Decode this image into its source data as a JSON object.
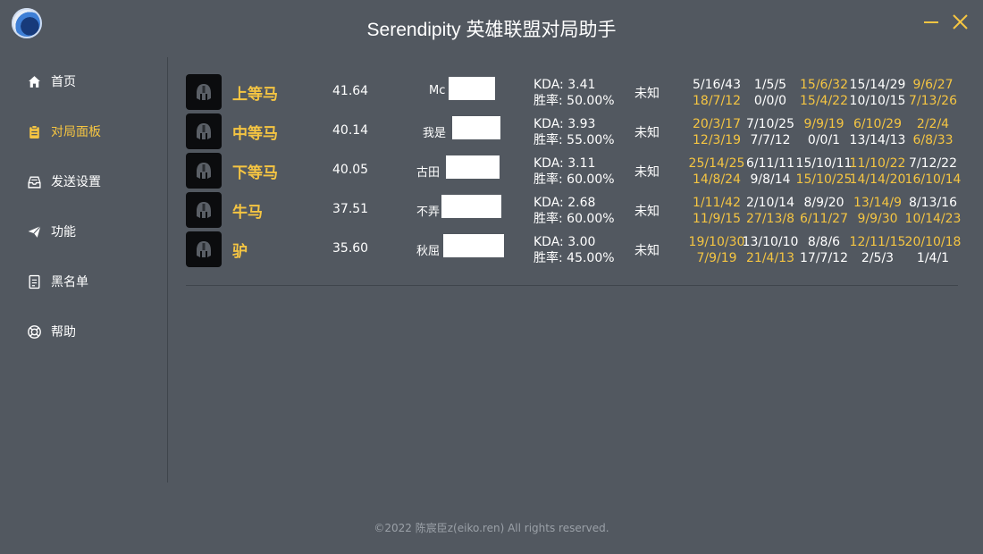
{
  "app": {
    "title": "Serendipity 英雄联盟对局助手"
  },
  "nav": [
    {
      "label": "首页",
      "icon": "home-icon",
      "active": false
    },
    {
      "label": "对局面板",
      "icon": "clipboard-icon",
      "active": true
    },
    {
      "label": "发送设置",
      "icon": "inbox-icon",
      "active": false
    },
    {
      "label": "功能",
      "icon": "send-icon",
      "active": false
    },
    {
      "label": "黑名单",
      "icon": "document-icon",
      "active": false
    },
    {
      "label": "帮助",
      "icon": "lifebuoy-icon",
      "active": false
    }
  ],
  "players": [
    {
      "tier": "上等马",
      "score": "41.64",
      "name_visible": "Mc",
      "kda": "KDA: 3.41",
      "winrate": "胜率: 50.00%",
      "rank": "未知",
      "games": [
        {
          "top": "5/16/43",
          "top_win": false,
          "bottom": "18/7/12",
          "bottom_win": true
        },
        {
          "top": "1/5/5",
          "top_win": false,
          "bottom": "0/0/0",
          "bottom_win": false
        },
        {
          "top": "15/6/32",
          "top_win": true,
          "bottom": "15/4/22",
          "bottom_win": true
        },
        {
          "top": "15/14/29",
          "top_win": false,
          "bottom": "10/10/15",
          "bottom_win": false
        },
        {
          "top": "9/6/27",
          "top_win": true,
          "bottom": "7/13/26",
          "bottom_win": true
        }
      ]
    },
    {
      "tier": "中等马",
      "score": "40.14",
      "name_visible": "我是",
      "kda": "KDA: 3.93",
      "winrate": "胜率: 55.00%",
      "rank": "未知",
      "games": [
        {
          "top": "20/3/17",
          "top_win": true,
          "bottom": "12/3/19",
          "bottom_win": true
        },
        {
          "top": "7/10/25",
          "top_win": false,
          "bottom": "7/7/12",
          "bottom_win": false
        },
        {
          "top": "9/9/19",
          "top_win": true,
          "bottom": "0/0/1",
          "bottom_win": false
        },
        {
          "top": "6/10/29",
          "top_win": true,
          "bottom": "13/14/13",
          "bottom_win": false
        },
        {
          "top": "2/2/4",
          "top_win": true,
          "bottom": "6/8/33",
          "bottom_win": true
        }
      ]
    },
    {
      "tier": "下等马",
      "score": "40.05",
      "name_visible": "古田",
      "kda": "KDA: 3.11",
      "winrate": "胜率: 60.00%",
      "rank": "未知",
      "games": [
        {
          "top": "25/14/25",
          "top_win": true,
          "bottom": "14/8/24",
          "bottom_win": true
        },
        {
          "top": "6/11/11",
          "top_win": false,
          "bottom": "9/8/14",
          "bottom_win": false
        },
        {
          "top": "15/10/11",
          "top_win": false,
          "bottom": "15/10/25",
          "bottom_win": true
        },
        {
          "top": "11/10/22",
          "top_win": true,
          "bottom": "14/14/20",
          "bottom_win": true
        },
        {
          "top": "7/12/22",
          "top_win": false,
          "bottom": "16/10/14",
          "bottom_win": true
        }
      ]
    },
    {
      "tier": "牛马",
      "score": "37.51",
      "name_visible": "不弄",
      "kda": "KDA: 2.68",
      "winrate": "胜率: 60.00%",
      "rank": "未知",
      "games": [
        {
          "top": "1/11/42",
          "top_win": true,
          "bottom": "11/9/15",
          "bottom_win": true
        },
        {
          "top": "2/10/14",
          "top_win": false,
          "bottom": "27/13/8",
          "bottom_win": true
        },
        {
          "top": "8/9/20",
          "top_win": false,
          "bottom": "6/11/27",
          "bottom_win": true
        },
        {
          "top": "13/14/9",
          "top_win": true,
          "bottom": "9/9/30",
          "bottom_win": true
        },
        {
          "top": "8/13/16",
          "top_win": false,
          "bottom": "10/14/23",
          "bottom_win": true
        }
      ]
    },
    {
      "tier": "驴",
      "score": "35.60",
      "name_visible": "秋屈",
      "kda": "KDA: 3.00",
      "winrate": "胜率: 45.00%",
      "rank": "未知",
      "games": [
        {
          "top": "19/10/30",
          "top_win": true,
          "bottom": "7/9/19",
          "bottom_win": true
        },
        {
          "top": "13/10/10",
          "top_win": false,
          "bottom": "21/4/13",
          "bottom_win": true
        },
        {
          "top": "8/8/6",
          "top_win": false,
          "bottom": "17/7/12",
          "bottom_win": false
        },
        {
          "top": "12/11/15",
          "top_win": true,
          "bottom": "2/5/3",
          "bottom_win": false
        },
        {
          "top": "20/10/18",
          "top_win": true,
          "bottom": "1/4/1",
          "bottom_win": false
        }
      ]
    }
  ],
  "footer": {
    "text": "©2022 陈宸臣z(eiko.ren) All rights reserved."
  },
  "colors": {
    "background": "#525860",
    "accent": "#f5c542",
    "text": "#ffffff"
  }
}
